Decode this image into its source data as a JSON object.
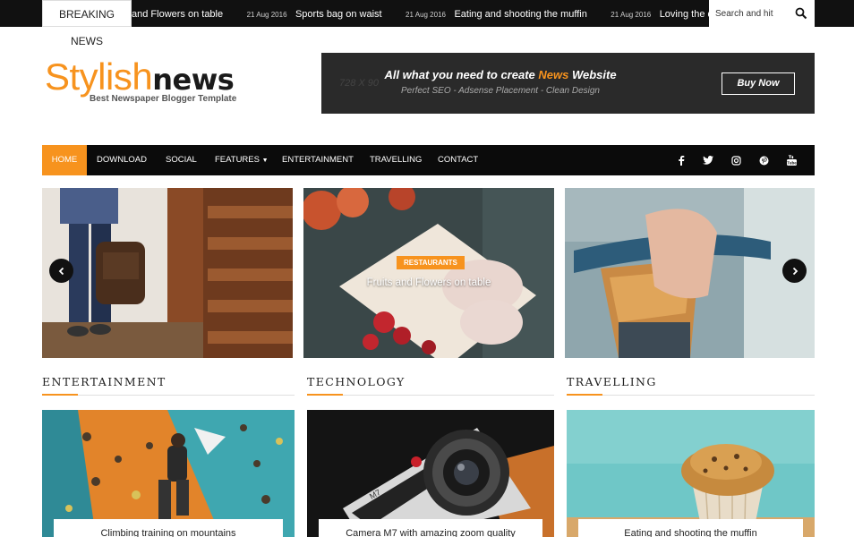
{
  "ticker": {
    "breaking_label": "BREAKING NEWS",
    "items": [
      {
        "date": "",
        "title": "and Flowers on table"
      },
      {
        "date": "21 Aug 2016",
        "title": "Sports bag on waist"
      },
      {
        "date": "21 Aug 2016",
        "title": "Eating and shooting the muffin"
      },
      {
        "date": "21 Aug 2016",
        "title": "Loving the quite feel at this"
      }
    ],
    "search_placeholder": "Search and hit"
  },
  "header": {
    "logo_part1": "Stylish",
    "logo_part2": "news",
    "tagline": "Best Newspaper Blogger Template",
    "banner": {
      "size_text": "728 X 90",
      "title_prefix": "All what you need to create ",
      "title_accent": "News",
      "title_suffix": " Website",
      "subtitle": "Perfect SEO - Adsense Placement - Clean Design",
      "button": "Buy Now"
    }
  },
  "nav": {
    "items": [
      "HOME",
      "DOWNLOAD",
      "SOCIAL",
      "FEATURES",
      "ENTERTAINMENT",
      "TRAVELLING",
      "CONTACT"
    ],
    "social": [
      "facebook-icon",
      "twitter-icon",
      "instagram-icon",
      "pinterest-icon",
      "youtube-icon"
    ]
  },
  "slider": {
    "category": "RESTAURANTS",
    "caption": "Fruits and Flowers on table"
  },
  "sections": [
    {
      "title": "ENTERTAINMENT",
      "card_title": "Climbing training on mountains"
    },
    {
      "title": "TECHNOLOGY",
      "card_title": "Camera M7 with amazing zoom quality"
    },
    {
      "title": "TRAVELLING",
      "card_title": "Eating and shooting the muffin"
    }
  ],
  "colors": {
    "accent": "#f7931e",
    "dark": "#0b0b0b"
  }
}
